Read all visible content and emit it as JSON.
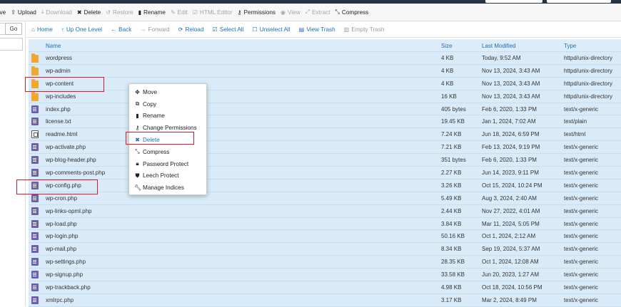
{
  "toolbar": {
    "items": [
      {
        "icon": "move-icon",
        "label": "ove",
        "disabled": false
      },
      {
        "icon": "upload-icon",
        "label": "Upload",
        "disabled": false
      },
      {
        "icon": "download-icon",
        "label": "Download",
        "disabled": true
      },
      {
        "icon": "delete-icon",
        "label": "Delete",
        "disabled": false
      },
      {
        "icon": "restore-icon",
        "label": "Restore",
        "disabled": true
      },
      {
        "icon": "rename-icon",
        "label": "Rename",
        "disabled": false
      },
      {
        "icon": "edit-icon",
        "label": "Edit",
        "disabled": true
      },
      {
        "icon": "html-editor-icon",
        "label": "HTML Editor",
        "disabled": true
      },
      {
        "icon": "permissions-icon",
        "label": "Permissions",
        "disabled": false
      },
      {
        "icon": "view-icon",
        "label": "View",
        "disabled": true
      },
      {
        "icon": "extract-icon",
        "label": "Extract",
        "disabled": true
      },
      {
        "icon": "compress-icon",
        "label": "Compress",
        "disabled": false
      }
    ]
  },
  "left_panel": {
    "go_label": "Go"
  },
  "navbar": {
    "items": [
      {
        "icon": "home-icon",
        "label": "Home",
        "disabled": false
      },
      {
        "icon": "up-level-icon",
        "label": "Up One Level",
        "disabled": false
      },
      {
        "icon": "back-icon",
        "label": "Back",
        "disabled": false
      },
      {
        "icon": "forward-icon",
        "label": "Forward",
        "disabled": true
      },
      {
        "icon": "reload-icon",
        "label": "Reload",
        "disabled": false
      },
      {
        "icon": "select-all-icon",
        "label": "Select All",
        "disabled": false
      },
      {
        "icon": "unselect-all-icon",
        "label": "Unselect All",
        "disabled": false
      },
      {
        "icon": "view-trash-icon",
        "label": "View Trash",
        "disabled": false
      },
      {
        "icon": "empty-trash-icon",
        "label": "Empty Trash",
        "disabled": true
      }
    ]
  },
  "table": {
    "headers": {
      "name": "Name",
      "size": "Size",
      "modified": "Last Modified",
      "type": "Type"
    },
    "rows": [
      {
        "kind": "folder",
        "name": "wordpress",
        "size": "4 KB",
        "modified": "Today, 9:52 AM",
        "type": "httpd/unix-directory"
      },
      {
        "kind": "folder",
        "name": "wp-admin",
        "size": "4 KB",
        "modified": "Nov 13, 2024, 3:43 AM",
        "type": "httpd/unix-directory"
      },
      {
        "kind": "folder",
        "name": "wp-content",
        "size": "4 KB",
        "modified": "Nov 13, 2024, 3:43 AM",
        "type": "httpd/unix-directory"
      },
      {
        "kind": "folder",
        "name": "wp-includes",
        "size": "16 KB",
        "modified": "Nov 13, 2024, 3:43 AM",
        "type": "httpd/unix-directory"
      },
      {
        "kind": "file",
        "name": "index.php",
        "size": "405 bytes",
        "modified": "Feb 6, 2020, 1:33 PM",
        "type": "text/x-generic"
      },
      {
        "kind": "file",
        "name": "license.txt",
        "size": "19.45 KB",
        "modified": "Jan 1, 2024, 7:02 AM",
        "type": "text/plain"
      },
      {
        "kind": "html",
        "name": "readme.html",
        "size": "7.24 KB",
        "modified": "Jun 18, 2024, 6:59 PM",
        "type": "text/html"
      },
      {
        "kind": "file",
        "name": "wp-activate.php",
        "size": "7.21 KB",
        "modified": "Feb 13, 2024, 9:19 PM",
        "type": "text/x-generic"
      },
      {
        "kind": "file",
        "name": "wp-blog-header.php",
        "size": "351 bytes",
        "modified": "Feb 6, 2020, 1:33 PM",
        "type": "text/x-generic"
      },
      {
        "kind": "file",
        "name": "wp-comments-post.php",
        "size": "2.27 KB",
        "modified": "Jun 14, 2023, 9:11 PM",
        "type": "text/x-generic"
      },
      {
        "kind": "file",
        "name": "wp-config.php",
        "size": "3.26 KB",
        "modified": "Oct 15, 2024, 10:24 PM",
        "type": "text/x-generic"
      },
      {
        "kind": "file",
        "name": "wp-cron.php",
        "size": "5.49 KB",
        "modified": "Aug 3, 2024, 2:40 AM",
        "type": "text/x-generic"
      },
      {
        "kind": "file",
        "name": "wp-links-opml.php",
        "size": "2.44 KB",
        "modified": "Nov 27, 2022, 4:01 AM",
        "type": "text/x-generic"
      },
      {
        "kind": "file",
        "name": "wp-load.php",
        "size": "3.84 KB",
        "modified": "Mar 11, 2024, 5:05 PM",
        "type": "text/x-generic"
      },
      {
        "kind": "file",
        "name": "wp-login.php",
        "size": "50.16 KB",
        "modified": "Oct 1, 2024, 2:12 AM",
        "type": "text/x-generic"
      },
      {
        "kind": "file",
        "name": "wp-mail.php",
        "size": "8.34 KB",
        "modified": "Sep 19, 2024, 5:37 AM",
        "type": "text/x-generic"
      },
      {
        "kind": "file",
        "name": "wp-settings.php",
        "size": "28.35 KB",
        "modified": "Oct 1, 2024, 12:08 AM",
        "type": "text/x-generic"
      },
      {
        "kind": "file",
        "name": "wp-signup.php",
        "size": "33.58 KB",
        "modified": "Jun 20, 2023, 1:27 AM",
        "type": "text/x-generic"
      },
      {
        "kind": "file",
        "name": "wp-trackback.php",
        "size": "4.98 KB",
        "modified": "Oct 18, 2024, 10:56 PM",
        "type": "text/x-generic"
      },
      {
        "kind": "file",
        "name": "xmlrpc.php",
        "size": "3.17 KB",
        "modified": "Mar 2, 2024, 8:49 PM",
        "type": "text/x-generic"
      }
    ]
  },
  "context_menu": {
    "items": [
      {
        "icon": "move-icon",
        "glyph": "✥",
        "label": "Move"
      },
      {
        "icon": "copy-icon",
        "glyph": "⧉",
        "label": "Copy"
      },
      {
        "icon": "rename-icon",
        "glyph": "▮",
        "label": "Rename"
      },
      {
        "icon": "key-icon",
        "glyph": "⚷",
        "label": "Change Permissions"
      },
      {
        "icon": "delete-icon",
        "glyph": "✖",
        "label": "Delete"
      },
      {
        "icon": "compress-icon",
        "glyph": "⤡",
        "label": "Compress"
      },
      {
        "icon": "lock-icon",
        "glyph": "🔒︎",
        "label": "Password Protect"
      },
      {
        "icon": "shield-icon",
        "glyph": "⛊",
        "label": "Leech Protect"
      },
      {
        "icon": "wrench-icon",
        "glyph": "🔧︎",
        "label": "Manage Indices"
      }
    ]
  },
  "colors": {
    "highlight": "#e0162b",
    "link": "#1d6fb8",
    "row_selected": "#d9ebf8",
    "topbar": "#263341"
  }
}
